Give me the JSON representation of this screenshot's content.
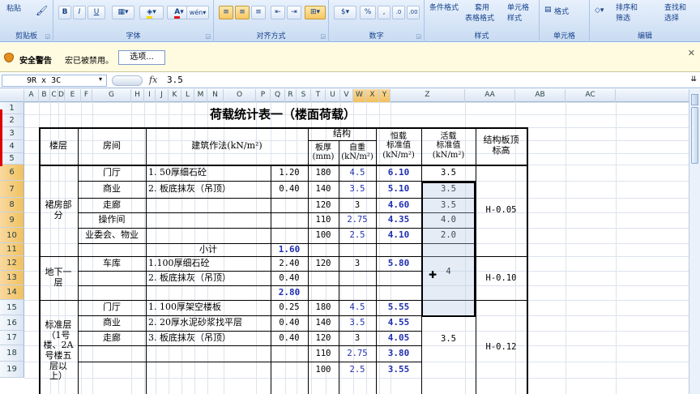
{
  "ribbon": {
    "paste": "粘贴",
    "clipboard": "剪贴板",
    "font": "字体",
    "alignment": "对齐方式",
    "number": "数字",
    "styles": "样式",
    "cells": "单元格",
    "editing": "编辑",
    "bold": "B",
    "italic": "I",
    "underline": "U",
    "wrap": "wrap",
    "percent": "%",
    "cond_format": "条件格式",
    "apply": "套用",
    "table_format": "表格格式",
    "cell_style_1": "单元格",
    "cell_style_2": "样式",
    "format": "格式",
    "sort_filter_1": "排序和",
    "sort_filter_2": "筛选",
    "find_1": "查找和",
    "find_2": "选择",
    "colors": {
      "font_color": "#e0151b",
      "fill_color": "#ffd800"
    }
  },
  "security": {
    "title": "安全警告",
    "message": "宏已被禁用。",
    "options": "选项..."
  },
  "formula_bar": {
    "name_box": "9R x 3C",
    "fx": "fx",
    "value": "3.5"
  },
  "columns": [
    "A",
    "B",
    "C",
    "D",
    "E",
    "F",
    "G",
    "H",
    "I",
    "J",
    "K",
    "L",
    "M",
    "N",
    "O",
    "P",
    "Q",
    "R",
    "S",
    "T",
    "U",
    "V",
    "W",
    "X",
    "Y",
    "Z",
    "AA",
    "AB",
    "AC"
  ],
  "rows": [
    "1",
    "2",
    "3",
    "4",
    "5",
    "6",
    "7",
    "8",
    "9",
    "10",
    "11",
    "12",
    "13",
    "14",
    "15",
    "16",
    "17",
    "18",
    "19"
  ],
  "table": {
    "title": "荷载统计表一（楼面荷载）",
    "h_floor": "楼层",
    "h_room": "房间",
    "h_method": "建筑作法(kN/m²)",
    "h_struct": "结构",
    "h_thick": "板厚",
    "h_thick_unit": "(mm)",
    "h_self": "自重",
    "h_self_unit": "(kN/m²)",
    "h_dead": "恒载",
    "h_dead_2": "标准值",
    "h_dead_unit": "(kN/m²)",
    "h_live": "活载",
    "h_live_2": "标准值",
    "h_live_unit": "(kN/m²)",
    "h_elev": "结构板顶",
    "h_elev_2": "标高",
    "floor1_a": "裙房部",
    "floor1_b": "分",
    "floor2_a": "地下一",
    "floor2_b": "层",
    "floor3_a": "标准层",
    "floor3_b": "（1号",
    "floor3_c": "楼、2A",
    "floor3_d": "号楼五",
    "floor3_e": "层以",
    "floor3_f": "上）",
    "r6": {
      "room": "门厅",
      "method": "1. 50厚细石砼",
      "val": "1.20",
      "thick": "180",
      "self": "4.5",
      "dead": "6.10",
      "live": "3.5"
    },
    "r7": {
      "room": "商业",
      "method": "2. 板底抹灰（吊顶）",
      "val": "0.40",
      "thick": "140",
      "self": "3.5",
      "dead": "5.10",
      "live": "3.5"
    },
    "r8": {
      "room": "走廊",
      "thick": "120",
      "self": "3",
      "dead": "4.60",
      "live": "3.5"
    },
    "r9": {
      "room": "操作间",
      "thick": "110",
      "self": "2.75",
      "dead": "4.35",
      "live": "4.0"
    },
    "r10": {
      "room": "业委会、物业",
      "thick": "100",
      "self": "2.5",
      "dead": "4.10",
      "live": "2.0"
    },
    "r11": {
      "subtotal": "小计",
      "val": "1.60"
    },
    "r12": {
      "room": "车库",
      "method": "1.100厚细石砼",
      "val": "2.40",
      "thick": "120",
      "self": "3",
      "dead": "5.80"
    },
    "r13": {
      "method": "2. 板底抹灰（吊顶）",
      "val": "0.40"
    },
    "r14": {
      "val": "2.80"
    },
    "r15": {
      "room": "门厅",
      "method": "1. 100厚架空楼板",
      "val": "0.25",
      "thick": "180",
      "self": "4.5",
      "dead": "5.55"
    },
    "r16": {
      "room": "商业",
      "method": "2. 20厚水泥砂浆找平层",
      "val": "0.40",
      "thick": "140",
      "self": "3.5",
      "dead": "4.55"
    },
    "r17": {
      "room": "走廊",
      "method": "3. 板底抹灰（吊顶）",
      "val": "0.40",
      "thick": "120",
      "self": "3",
      "dead": "4.05"
    },
    "r18": {
      "thick": "110",
      "self": "2.75",
      "dead": "3.80"
    },
    "r19": {
      "thick": "100",
      "self": "2.5",
      "dead": "3.55"
    },
    "live_basement": "4",
    "live_std": "3.5",
    "elev1": "H-0.05",
    "elev2": "H-0.10",
    "elev3": "H-0.12"
  }
}
